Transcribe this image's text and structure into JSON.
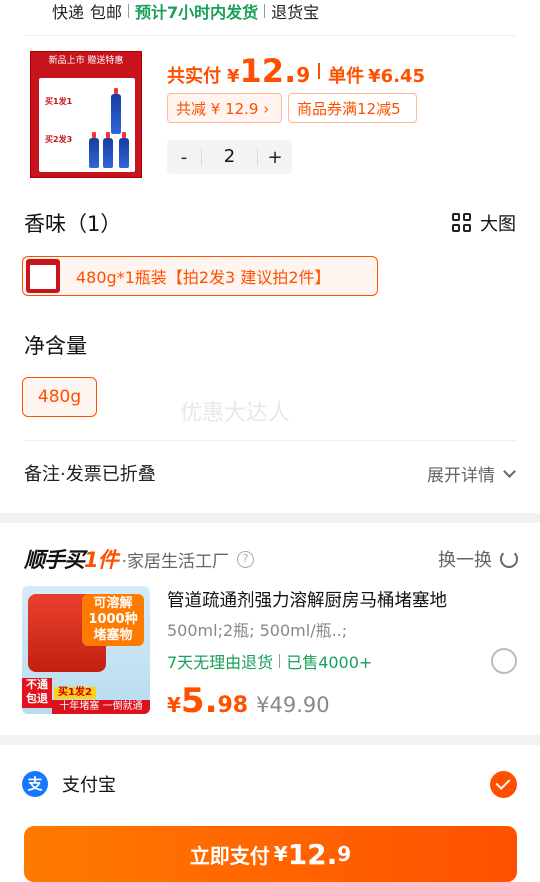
{
  "shipping": {
    "items": [
      "快递",
      "包邮"
    ],
    "eta": "预计7小时内发货",
    "return": "退货宝"
  },
  "product": {
    "image_header": "新品上市 赠送特惠",
    "image_labels": [
      "买1发1",
      "买2发3"
    ],
    "pay_label": "共实付",
    "currency": "¥",
    "price_int": "12.",
    "price_dec": "9",
    "unit_label": "单件",
    "unit_price": "¥6.45",
    "promo_discount": "共减 ¥ 12.9 ›",
    "promo_coupon": "商品券满12减5",
    "qty": "2",
    "qty_minus": "-",
    "qty_plus": "+"
  },
  "scent": {
    "title": "香味（1）",
    "big_view": "大图",
    "option": "480g*1瓶装【拍2发3 建议拍2件】"
  },
  "net": {
    "title": "净含量",
    "option": "480g"
  },
  "watermark": "优惠大达人",
  "remark": {
    "label": "备注·发票已折叠",
    "expand": "展开详情"
  },
  "recommend": {
    "logo_a": "顺手买",
    "logo_b": "1件",
    "store": "·家居生活工厂",
    "help": "?",
    "swap": "换一换",
    "name": "管道疏通剂强力溶解厨房马桶堵塞地",
    "spec": "500ml;2瓶;  500ml/瓶..;",
    "return_badge": "7天无理由退货",
    "sold": "已售4000+",
    "currency": "¥",
    "price_int": "5.",
    "price_dec": "98",
    "orig_price": "¥49.90",
    "img_bubble": "可溶解 1000种 堵塞物",
    "img_tag": "不通 包退",
    "img_mini": "买1发2",
    "img_strip": "十年堵塞 一倒就通"
  },
  "payment": {
    "method": "支付宝",
    "icon_char": "支",
    "button_label": "立即支付",
    "currency": "¥",
    "price_int": "12.",
    "price_dec": "9"
  },
  "colors": {
    "accent": "#ff5000",
    "green": "#19a05a",
    "alipay": "#1677ff"
  }
}
